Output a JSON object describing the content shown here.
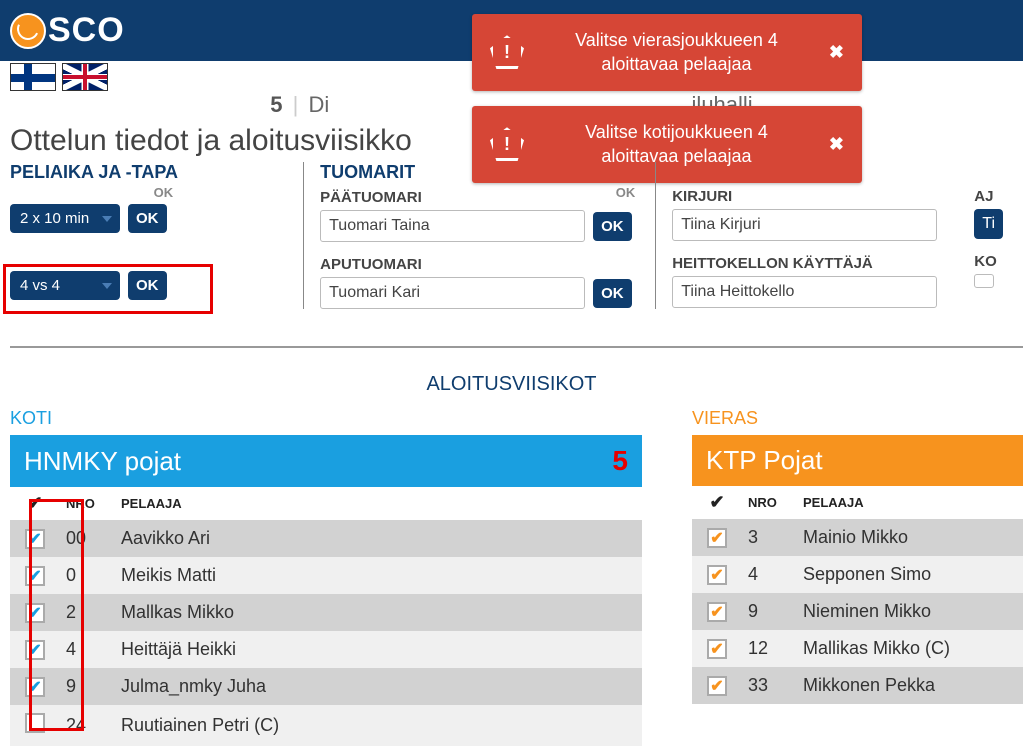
{
  "app": {
    "logo_text": "SCO"
  },
  "breadcrumb": {
    "num": "5",
    "text1": "Di",
    "text2": "iluhalli"
  },
  "page_title": "Ottelun tiedot ja aloitusviisikko",
  "toasts": {
    "t1": {
      "line1": "Valitse vierasjoukkueen 4",
      "line2": "aloittavaa pelaajaa"
    },
    "t2": {
      "line1": "Valitse kotijoukkueen 4",
      "line2": "aloittavaa pelaajaa"
    }
  },
  "form": {
    "peliaika_label": "PELIAIKA JA -TAPA",
    "ok_label": "OK",
    "duration": "2 x 10 min",
    "format": "4 vs 4",
    "tuomarit_label": "TUOMARIT",
    "paatuomari_label": "PÄÄTUOMARI",
    "paatuomari_value": "Tuomari Taina",
    "aputuomari_label": "APUTUOMARI",
    "aputuomari_value": "Tuomari Kari",
    "kirjuri_label": "KIRJURI",
    "kirjuri_value": "Tiina Kirjuri",
    "heitto_label": "HEITTOKELLON KÄYTTÄJÄ",
    "heitto_value": "Tiina Heittokello",
    "aja_label": "AJ",
    "aja_value": "Ti",
    "kon_label": "KO"
  },
  "center_label": "ALOITUSVIISIKOT",
  "home": {
    "side_label": "KOTI",
    "team": "HNMKY pojat",
    "count": "5",
    "headers": {
      "nro": "NRO",
      "pelaaja": "PELAAJA"
    },
    "players": [
      {
        "nro": "00",
        "name": "Aavikko Ari",
        "checked": true
      },
      {
        "nro": "0",
        "name": "Meikis Matti",
        "checked": true
      },
      {
        "nro": "2",
        "name": "Mallkas Mikko",
        "checked": true
      },
      {
        "nro": "4",
        "name": "Heittäjä Heikki",
        "checked": true
      },
      {
        "nro": "9",
        "name": "Julma_nmky Juha",
        "checked": true
      },
      {
        "nro": "24",
        "name": "Ruutiainen Petri (C)",
        "checked": false
      }
    ]
  },
  "away": {
    "side_label": "VIERAS",
    "team": "KTP Pojat",
    "headers": {
      "nro": "NRO",
      "pelaaja": "PELAAJA"
    },
    "players": [
      {
        "nro": "3",
        "name": "Mainio Mikko",
        "checked": true
      },
      {
        "nro": "4",
        "name": "Sepponen Simo",
        "checked": true
      },
      {
        "nro": "9",
        "name": "Nieminen Mikko",
        "checked": true
      },
      {
        "nro": "12",
        "name": "Mallikas Mikko (C)",
        "checked": true
      },
      {
        "nro": "33",
        "name": "Mikkonen Pekka",
        "checked": true
      }
    ]
  }
}
